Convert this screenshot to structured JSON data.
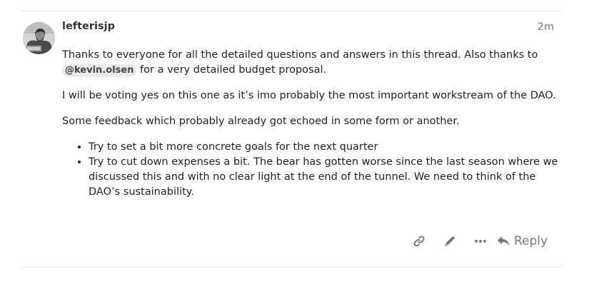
{
  "post": {
    "username": "lefterisjp",
    "timestamp": "2m",
    "paragraph1_before": "Thanks to everyone for all the detailed questions and answers in this thread. Also thanks to ",
    "mention": "@kevin.olsen",
    "paragraph1_after": " for a very detailed budget proposal.",
    "paragraph2": "I will be voting yes on this one as it’s imo probably the most important workstream of the DAO.",
    "paragraph3": "Some feedback which probably already got echoed in some form or another.",
    "bullets": [
      "Try to set a bit more concrete goals for the next quarter",
      "Try to cut down expenses a bit. The bear has gotten worse since the last season where we discussed this and with no clear light at the end of the tunnel. We need to think of the DAO’s sustainability."
    ]
  },
  "actions": {
    "copy_link_icon": "link-icon",
    "edit_icon": "pencil-icon",
    "more_icon": "ellipsis-icon",
    "reply_icon": "reply-arrow-icon",
    "reply_label": "Reply"
  },
  "colors": {
    "icon": "#777777",
    "mention_bg": "#e9e9e9",
    "divider": "#e9e9e9"
  }
}
